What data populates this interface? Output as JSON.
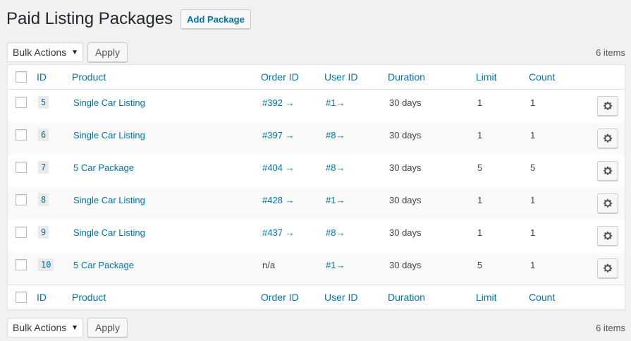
{
  "page": {
    "title": "Paid Listing Packages",
    "add_button": "Add Package"
  },
  "tablenav": {
    "bulk_actions": "Bulk Actions",
    "apply": "Apply",
    "items_count": "6 items"
  },
  "columns": {
    "id": "ID",
    "product": "Product",
    "order_id": "Order ID",
    "user_id": "User ID",
    "duration": "Duration",
    "limit": "Limit",
    "count": "Count"
  },
  "rows": [
    {
      "id": "5",
      "product": "Single Car Listing",
      "order_id": "#392 →",
      "order_link": true,
      "user_id": "#1→",
      "duration": "30 days",
      "limit": "1",
      "count": "1"
    },
    {
      "id": "6",
      "product": "Single Car Listing",
      "order_id": "#397 →",
      "order_link": true,
      "user_id": "#8→",
      "duration": "30 days",
      "limit": "1",
      "count": "1"
    },
    {
      "id": "7",
      "product": "5 Car Package",
      "order_id": "#404 →",
      "order_link": true,
      "user_id": "#8→",
      "duration": "30 days",
      "limit": "5",
      "count": "5"
    },
    {
      "id": "8",
      "product": "Single Car Listing",
      "order_id": "#428 →",
      "order_link": true,
      "user_id": "#1→",
      "duration": "30 days",
      "limit": "1",
      "count": "1"
    },
    {
      "id": "9",
      "product": "Single Car Listing",
      "order_id": "#437 →",
      "order_link": true,
      "user_id": "#8→",
      "duration": "30 days",
      "limit": "1",
      "count": "1"
    },
    {
      "id": "10",
      "product": "5 Car Package",
      "order_id": "n/a",
      "order_link": false,
      "user_id": "#1→",
      "duration": "30 days",
      "limit": "5",
      "count": "1"
    }
  ],
  "icons": {
    "row_action": "gear-icon",
    "select_arrow": "caret-down-icon"
  },
  "colors": {
    "link": "#0073aa",
    "background": "#f1f1f1",
    "alt_row": "#f9f9f9"
  }
}
